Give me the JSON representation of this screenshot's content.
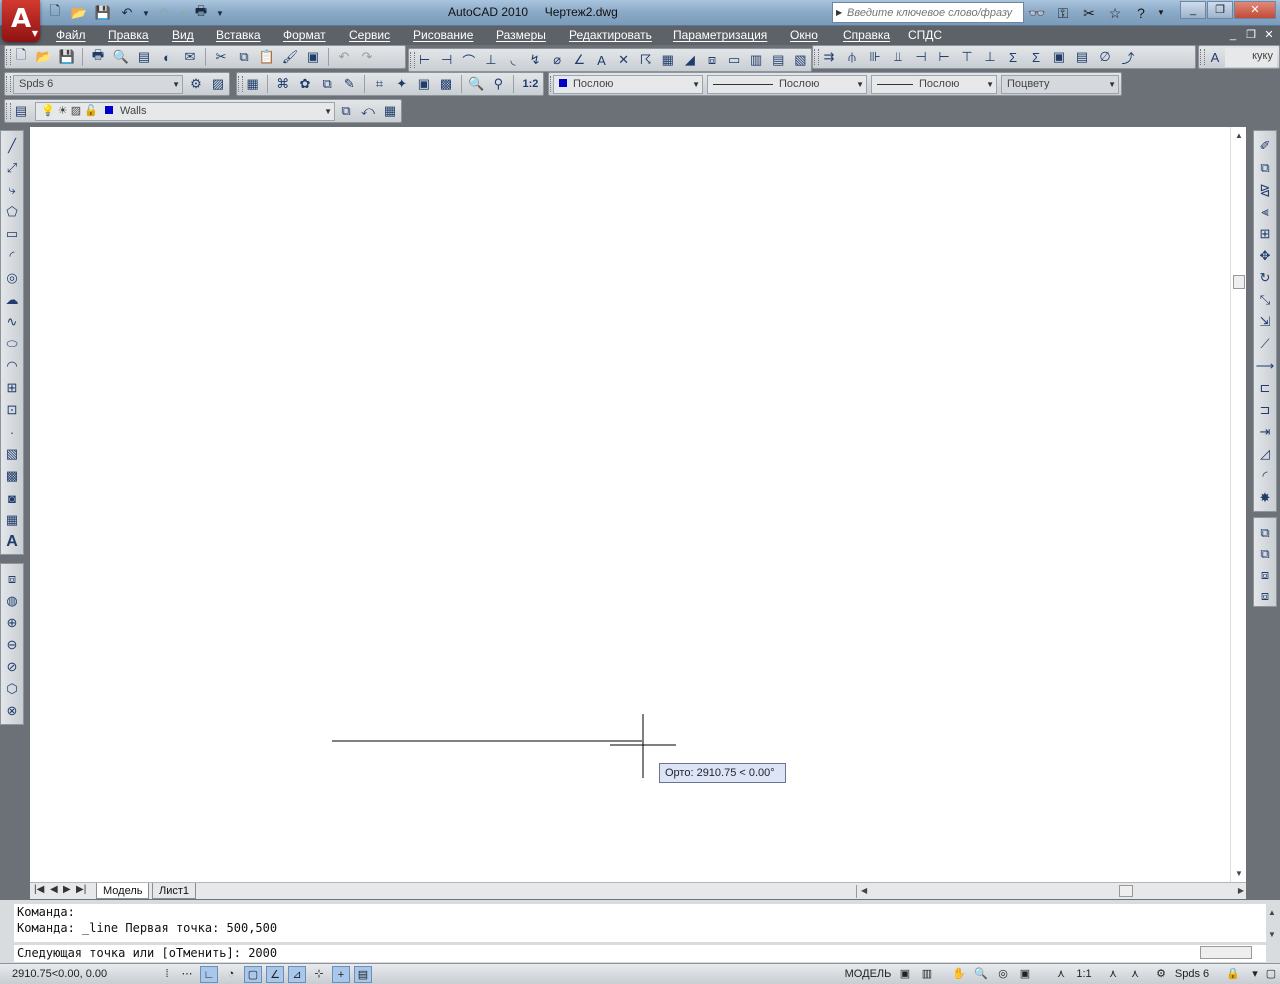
{
  "window": {
    "app_title": "AutoCAD 2010",
    "doc_title": "Чертеж2.dwg",
    "search_placeholder": "Введите ключевое слово/фразу"
  },
  "menu": [
    "Файл",
    "Правка",
    "Вид",
    "Вставка",
    "Формат",
    "Сервис",
    "Рисование",
    "Размеры",
    "Редактировать",
    "Параметризация",
    "Окно",
    "Справка",
    "СПДС"
  ],
  "toolbars": {
    "workspace_combo": "Spds 6",
    "layer_combo": "Walls",
    "color_combo": "Послою",
    "linetype_combo": "Послою",
    "lineweight_combo": "Послою",
    "plotstyle_combo": "Поцвету",
    "annotation_scale": "1:2",
    "style_text": "куку"
  },
  "drawing": {
    "ortho_tooltip": "Орто: 2910.75 < 0.00°"
  },
  "tabs": {
    "model": "Модель",
    "layout1": "Лист1"
  },
  "command": {
    "history_line1": "Команда:",
    "history_line2": "Команда: _line Первая точка: 500,500",
    "prompt": "Следующая точка или [оТменить]: 2000"
  },
  "status": {
    "coords": "2910.75<0.00, 0.00",
    "model_label": "МОДЕЛЬ",
    "scale": "1:1",
    "workspace": "Spds 6"
  },
  "colors": {
    "accent": "#a9c4dd",
    "menubar": "#5c6268",
    "background": "#6b7176"
  }
}
